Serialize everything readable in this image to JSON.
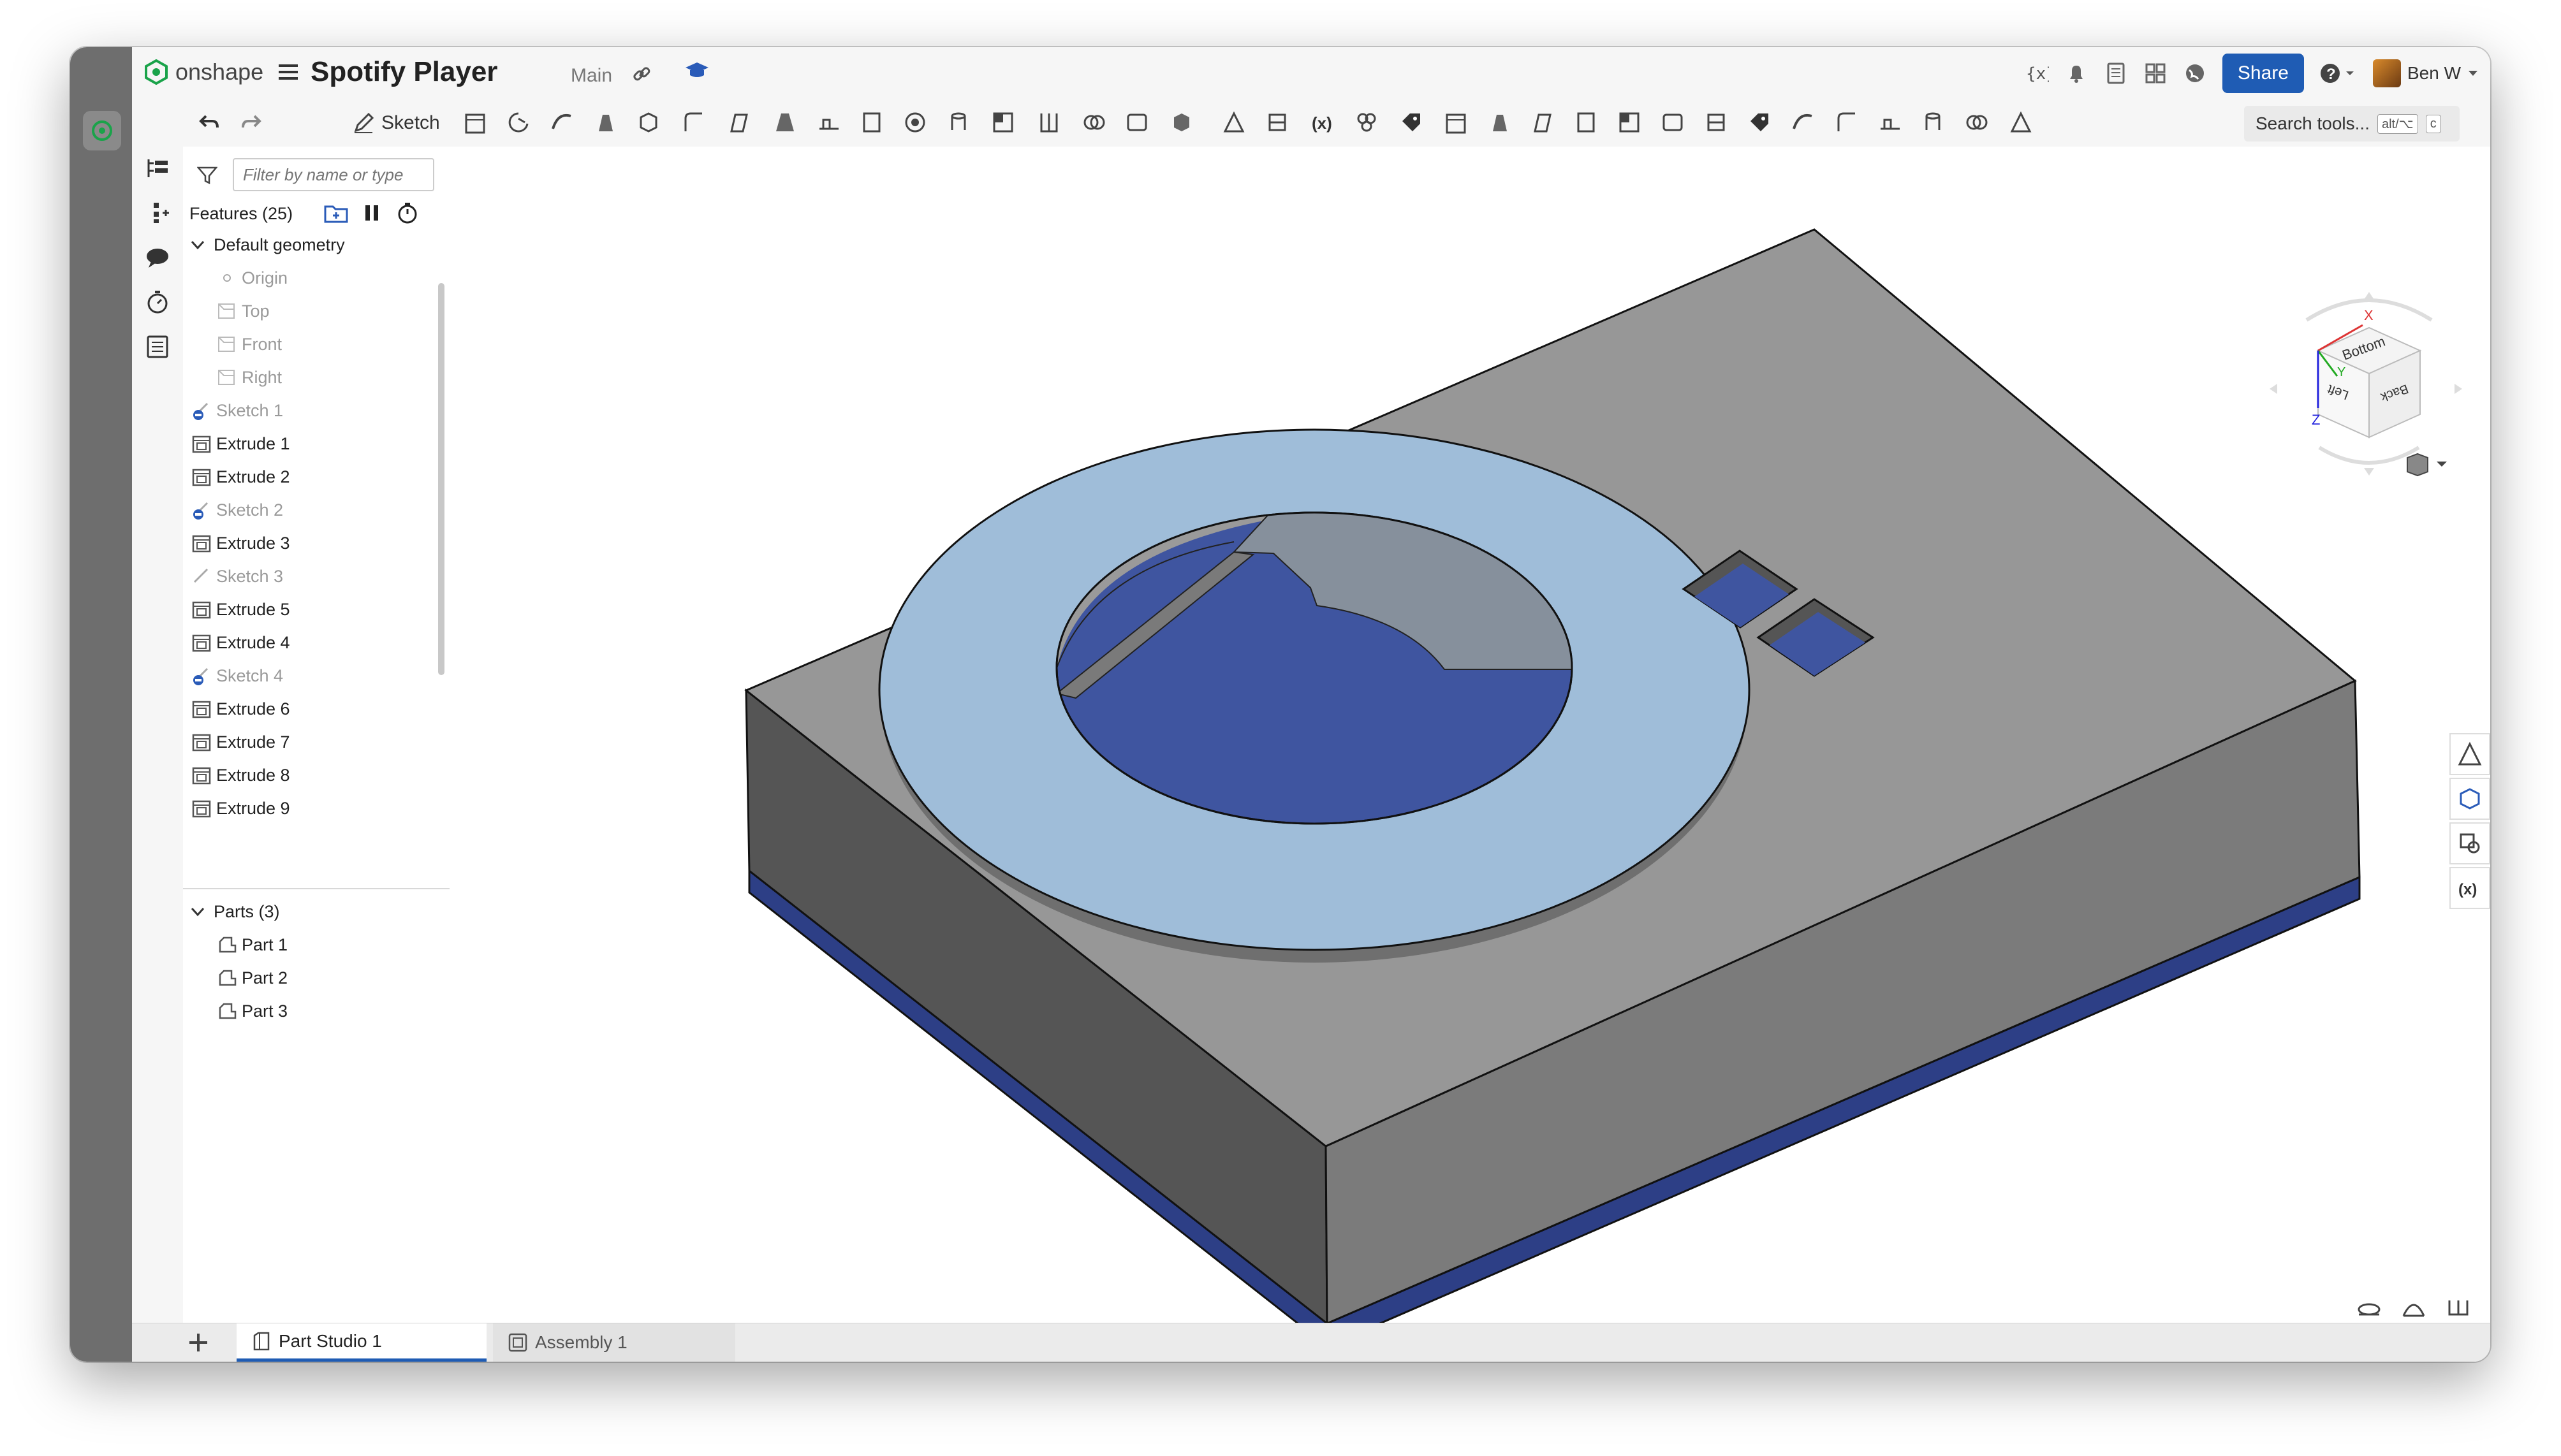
{
  "app": {
    "brand": "onshape",
    "document_title": "Spotify Player",
    "branch": "Main",
    "accent_color": "#1f5cb4"
  },
  "topbar": {
    "share_label": "Share",
    "user_name": "Ben W",
    "icons": [
      "variables-icon",
      "bell-icon",
      "document-icon",
      "grid-icon",
      "globe-icon",
      "help-icon"
    ]
  },
  "toolbar": {
    "sketch_label": "Sketch",
    "search_label": "Search tools...",
    "search_shortcut_1": "alt/⌥",
    "search_shortcut_2": "c"
  },
  "feature_panel": {
    "filter_placeholder": "Filter by name or type",
    "features_header": "Features (25)",
    "default_geometry": "Default geometry",
    "items": [
      {
        "label": "Origin"
      },
      {
        "label": "Top"
      },
      {
        "label": "Front"
      },
      {
        "label": "Right"
      },
      {
        "label": "Sketch 1"
      },
      {
        "label": "Extrude 1"
      },
      {
        "label": "Extrude 2"
      },
      {
        "label": "Sketch 2"
      },
      {
        "label": "Extrude 3"
      },
      {
        "label": "Sketch 3"
      },
      {
        "label": "Extrude 5"
      },
      {
        "label": "Extrude 4"
      },
      {
        "label": "Sketch 4"
      },
      {
        "label": "Extrude 6"
      },
      {
        "label": "Extrude 7"
      },
      {
        "label": "Extrude 8"
      },
      {
        "label": "Extrude 9"
      }
    ],
    "parts_header": "Parts (3)",
    "parts": [
      {
        "label": "Part 1"
      },
      {
        "label": "Part 2"
      },
      {
        "label": "Part 3"
      }
    ]
  },
  "viewcube": {
    "faces": [
      "Bottom",
      "Left",
      "Back"
    ],
    "axes": [
      "X",
      "Y",
      "Z"
    ]
  },
  "tabs": [
    {
      "label": "Part Studio 1"
    },
    {
      "label": "Assembly 1"
    }
  ],
  "model_colors": {
    "body_top": "#9a9a9a",
    "body_left": "#5a5a5a",
    "body_right": "#7a7a7a",
    "ring": "#9fbdd9",
    "pocket": "#3f55a0",
    "base_plate": "#2d3f86"
  }
}
